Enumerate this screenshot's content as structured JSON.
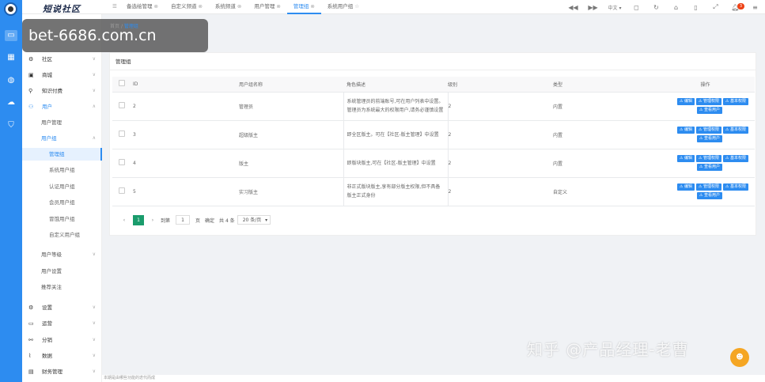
{
  "app": {
    "logo": "短说社区"
  },
  "banner": {
    "text": "bet-6686.com.cn"
  },
  "header": {
    "tabs": [
      {
        "label": "备选绘管理"
      },
      {
        "label": "自定义频道"
      },
      {
        "label": "系统频道"
      },
      {
        "label": "用户管理"
      },
      {
        "label": "管理组",
        "active": true
      },
      {
        "label": "系统用户组"
      }
    ],
    "lang": "中文",
    "notification_count": "3"
  },
  "sidebar": {
    "items": [
      {
        "label": "社区"
      },
      {
        "label": "商城"
      },
      {
        "label": "知识付费"
      },
      {
        "label": "用户"
      }
    ],
    "user_subs": [
      {
        "label": "用户管理"
      },
      {
        "label": "用户组"
      }
    ],
    "group_subs": [
      {
        "label": "管理组"
      },
      {
        "label": "系统用户组"
      },
      {
        "label": "认证用户组"
      },
      {
        "label": "会员用户组"
      },
      {
        "label": "冒饿用户组"
      },
      {
        "label": "自定义用户组"
      }
    ],
    "more_subs": [
      {
        "label": "用户等级"
      },
      {
        "label": "用户设置"
      },
      {
        "label": "推荐关注"
      }
    ],
    "bottom_items": [
      {
        "label": "设置"
      },
      {
        "label": "运营"
      },
      {
        "label": "分销"
      },
      {
        "label": "数据"
      },
      {
        "label": "财务管理"
      }
    ]
  },
  "breadcrumb": {
    "home": "首页",
    "current": "管理组"
  },
  "card": {
    "title": "管理组"
  },
  "table": {
    "headers": [
      "ID",
      "用户组名称",
      "角色描述",
      "级别",
      "类型",
      "操作"
    ],
    "rows": [
      {
        "id": "2",
        "name": "管理员",
        "desc": "系统管理员的前端账号,可在用户列表中设置。管理员为系统最大的权限用户,请务必谨慎设置",
        "level": "2",
        "type": "内置"
      },
      {
        "id": "3",
        "name": "超级版主",
        "desc": "即全区版主。可在【社区-版主管理】中设置",
        "level": "2",
        "type": "内置"
      },
      {
        "id": "4",
        "name": "版主",
        "desc": "即版块版主,可在【社区-版主管理】中设置",
        "level": "2",
        "type": "内置"
      },
      {
        "id": "5",
        "name": "实习版主",
        "desc": "非正式版块版主,享有部分版主权限,但不具备版主正式身份",
        "level": "2",
        "type": "自定义"
      }
    ],
    "actions": {
      "edit": "编辑",
      "manage_perm": "管理权限",
      "base_perm": "基本权限",
      "view_users": "查看用户"
    }
  },
  "pager": {
    "current": "1",
    "goto_label": "到第",
    "page_input": "1",
    "page_unit": "页",
    "confirm": "确定",
    "total": "共 4 条",
    "page_size": "20 条/页"
  },
  "footer": {
    "text": "本期是由哪些功能的迭代而成"
  },
  "watermark": {
    "text": "知乎 @产品经理-老曹"
  }
}
